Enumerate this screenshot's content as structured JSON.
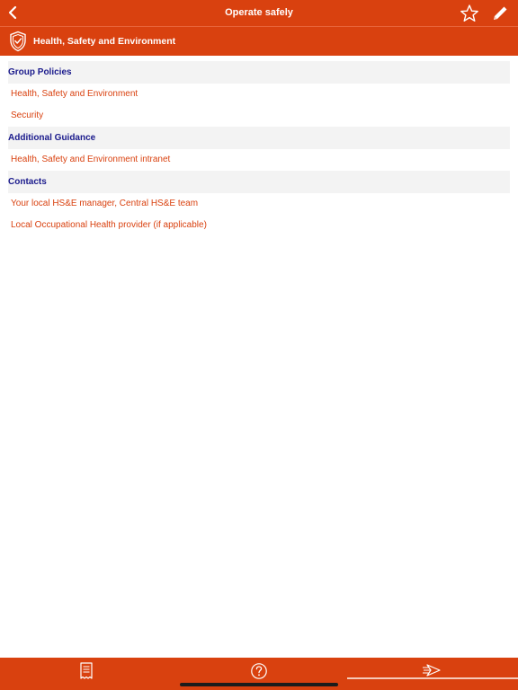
{
  "navbar": {
    "title": "Operate safely",
    "back_icon": "chevron-left-icon",
    "favorite_icon": "star-icon",
    "edit_icon": "pencil-icon"
  },
  "subheader": {
    "icon": "shield-check-icon",
    "title": "Health, Safety and Environment"
  },
  "sections": [
    {
      "header": "Group Policies",
      "items": [
        "Health, Safety and Environment",
        "Security"
      ]
    },
    {
      "header": "Additional Guidance",
      "items": [
        "Health, Safety and Environment intranet"
      ]
    },
    {
      "header": "Contacts",
      "items": [
        "Your local HS&E manager, Central HS&E team",
        "Local Occupational Health provider (if applicable)"
      ]
    }
  ],
  "tabbar": {
    "tabs": [
      {
        "icon": "document-icon",
        "selected": false
      },
      {
        "icon": "question-icon",
        "selected": false
      },
      {
        "icon": "speed-arrow-icon",
        "selected": true
      }
    ]
  },
  "colors": {
    "brand": "#d9410f",
    "section_header_text": "#1a1a8c",
    "link_text": "#d9410f",
    "section_header_bg": "#f3f3f3"
  }
}
